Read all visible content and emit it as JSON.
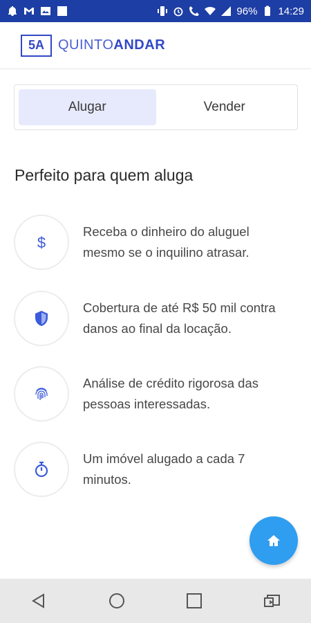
{
  "status_bar": {
    "battery": "96%",
    "time": "14:29"
  },
  "header": {
    "logo_mark": "5A",
    "brand_thin": "QUINTO",
    "brand_bold": "ANDAR"
  },
  "tabs": [
    {
      "label": "Alugar",
      "active": true
    },
    {
      "label": "Vender",
      "active": false
    }
  ],
  "section_title": "Perfeito para quem aluga",
  "benefits": [
    {
      "icon": "dollar-icon",
      "text": "Receba o dinheiro do aluguel mesmo se o inquilino atrasar."
    },
    {
      "icon": "shield-icon",
      "text": "Cobertura de até R$ 50 mil contra danos ao final da locação."
    },
    {
      "icon": "fingerprint-icon",
      "text": "Análise de crédito rigorosa das pessoas interessadas."
    },
    {
      "icon": "stopwatch-icon",
      "text": "Um imóvel alugado a cada 7 minutos."
    }
  ],
  "fab": {
    "icon": "home-icon"
  },
  "colors": {
    "status_bar": "#1d3ea4",
    "brand": "#3148c6",
    "accent_icon": "#3b5bdb",
    "fab": "#2f9df0",
    "tab_active_bg": "#e7eafc"
  }
}
